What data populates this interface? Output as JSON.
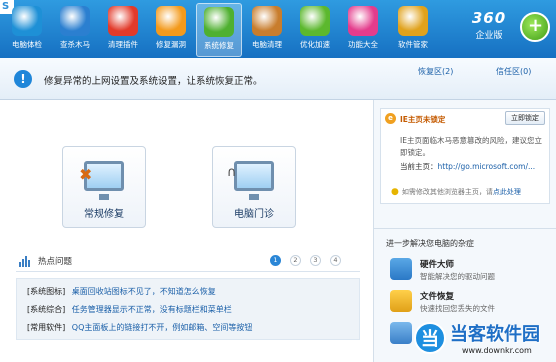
{
  "toolbar": {
    "items": [
      {
        "label": "电脑体检",
        "icon": "checkup-icon",
        "color": "#1e90d6"
      },
      {
        "label": "查杀木马",
        "icon": "shield-icon",
        "color": "#2b7fd0"
      },
      {
        "label": "清理插件",
        "icon": "plugin-icon",
        "color": "#e23a2a"
      },
      {
        "label": "修复漏洞",
        "icon": "patch-icon",
        "color": "#f39a1c"
      },
      {
        "label": "系统修复",
        "icon": "monitor-icon",
        "color": "#4fb030"
      },
      {
        "label": "电脑清理",
        "icon": "broom-icon",
        "color": "#c87d2d"
      },
      {
        "label": "优化加速",
        "icon": "speedup-icon",
        "color": "#5cb82e"
      },
      {
        "label": "功能大全",
        "icon": "app-grid-icon",
        "color": "#e43c8c"
      },
      {
        "label": "软件管家",
        "icon": "software-grid-icon",
        "color": "#e0a21c"
      }
    ],
    "active_index": 4,
    "brand_top": "360",
    "brand_bottom": "企业版",
    "logo_glyph": "+"
  },
  "infobar": {
    "icon_glyph": "!",
    "text": "修复异常的上网设置及系统设置，让系统恢复正常。",
    "restore_link": "恢复区(2)",
    "trust_link": "信任区(0)"
  },
  "main": {
    "buttons": [
      {
        "label": "常规修复",
        "icon": "tools-icon",
        "glyph": "✖"
      },
      {
        "label": "电脑门诊",
        "icon": "stethoscope-icon",
        "glyph": "∩"
      }
    ],
    "hot": {
      "title": "热点问题",
      "pages": [
        "1",
        "2",
        "3",
        "4"
      ],
      "active_page": 0,
      "rows": [
        {
          "category": "[系统图标]",
          "text": "桌面回收站图标不见了，不知道怎么恢复"
        },
        {
          "category": "[系统综合]",
          "text": "任务管理器显示不正常，没有标题栏和菜单栏"
        },
        {
          "category": "[常用软件]",
          "text": "QQ主面板上的链接打不开，例如邮箱、空间等按钮"
        }
      ]
    }
  },
  "side": {
    "ie": {
      "icon_glyph": "e",
      "title": "IE主页未锁定",
      "lock_button": "立即锁定",
      "desc": "IE主页面临木马恶意篡改的风险，建议您立即锁定。",
      "home_label": "当前主页：",
      "home_url": "http://go.microsoft.com/...",
      "tip": "如需修改其他浏览器主页，请",
      "tip_link": "点此处理",
      "tip_icon": "lightbulb-icon"
    },
    "next_title": "进一步解决您电脑的杂症",
    "services": [
      {
        "name": "硬件大师",
        "desc": "智能解决您的驱动问题",
        "icon": "hardware-icon",
        "color": "#3b8fd6"
      },
      {
        "name": "文件恢复",
        "desc": "快速找回您丢失的文件",
        "icon": "file-recovery-icon",
        "color": "#f0b020"
      },
      {
        "name": "",
        "desc": "",
        "icon": "network-icon",
        "color": "#4a90d9"
      }
    ]
  },
  "watermark": {
    "badge": "当",
    "text": "当客软件园",
    "url": "www.downkr.com"
  }
}
